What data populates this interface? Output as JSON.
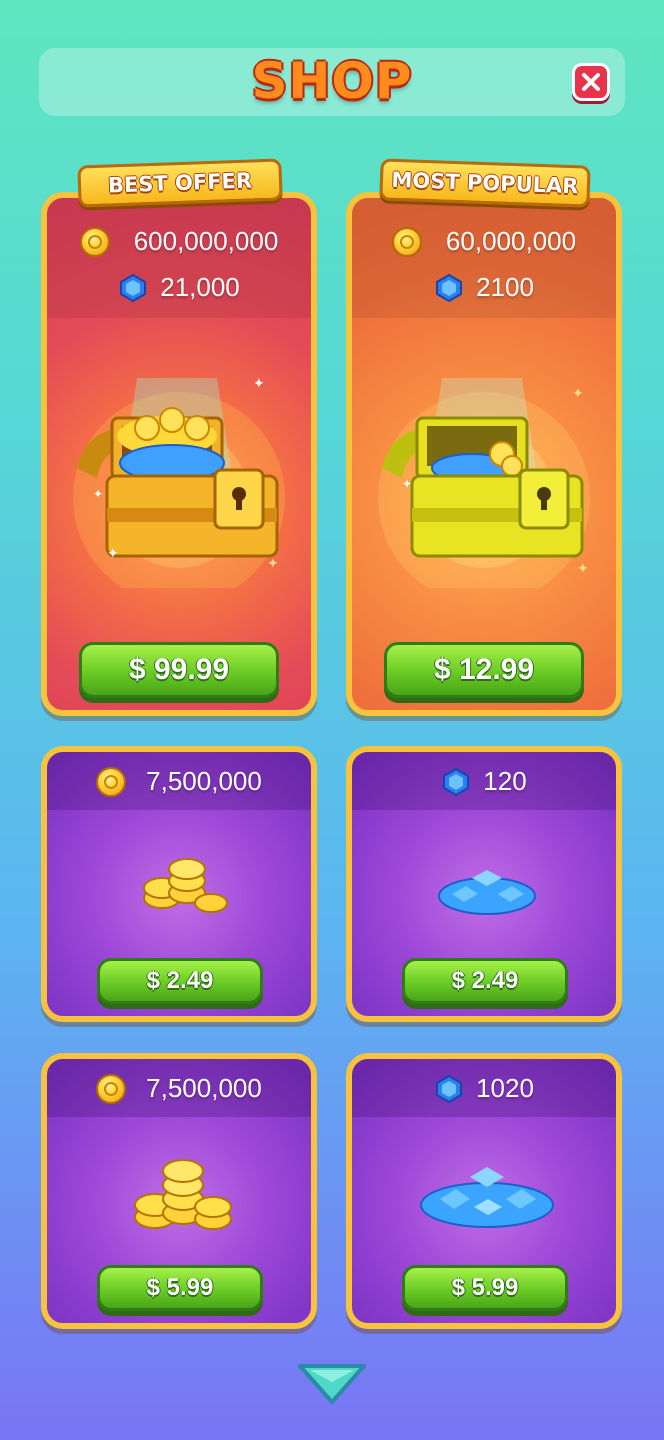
{
  "header": {
    "title": "SHOP"
  },
  "offers": [
    {
      "ribbon": "BEST OFFER",
      "coins": "600,000,000",
      "gems": "21,000",
      "price": "$ 99.99"
    },
    {
      "ribbon": "MOST POPULAR",
      "coins": "60,000,000",
      "gems": "2100",
      "price": "$ 12.99"
    }
  ],
  "packs": [
    {
      "kind": "coins",
      "amount": "7,500,000",
      "price": "$ 2.49",
      "icon": "coin-icon"
    },
    {
      "kind": "gems",
      "amount": "120",
      "price": "$ 2.49",
      "icon": "gem-icon"
    },
    {
      "kind": "coins",
      "amount": "7,500,000",
      "price": "$ 5.99",
      "icon": "coin-icon"
    },
    {
      "kind": "gems",
      "amount": "1020",
      "price": "$ 5.99",
      "icon": "gem-icon"
    }
  ],
  "icons": {
    "close": "close-icon",
    "scroll": "chevron-down-icon",
    "coin": "coin-icon",
    "gem": "gem-icon",
    "chest": "treasure-chest-icon"
  },
  "colors": {
    "accent_title": "#ff8a1e",
    "button_green": "#6acb24",
    "card_border": "#f7c23c",
    "close_red": "#e8334b"
  }
}
